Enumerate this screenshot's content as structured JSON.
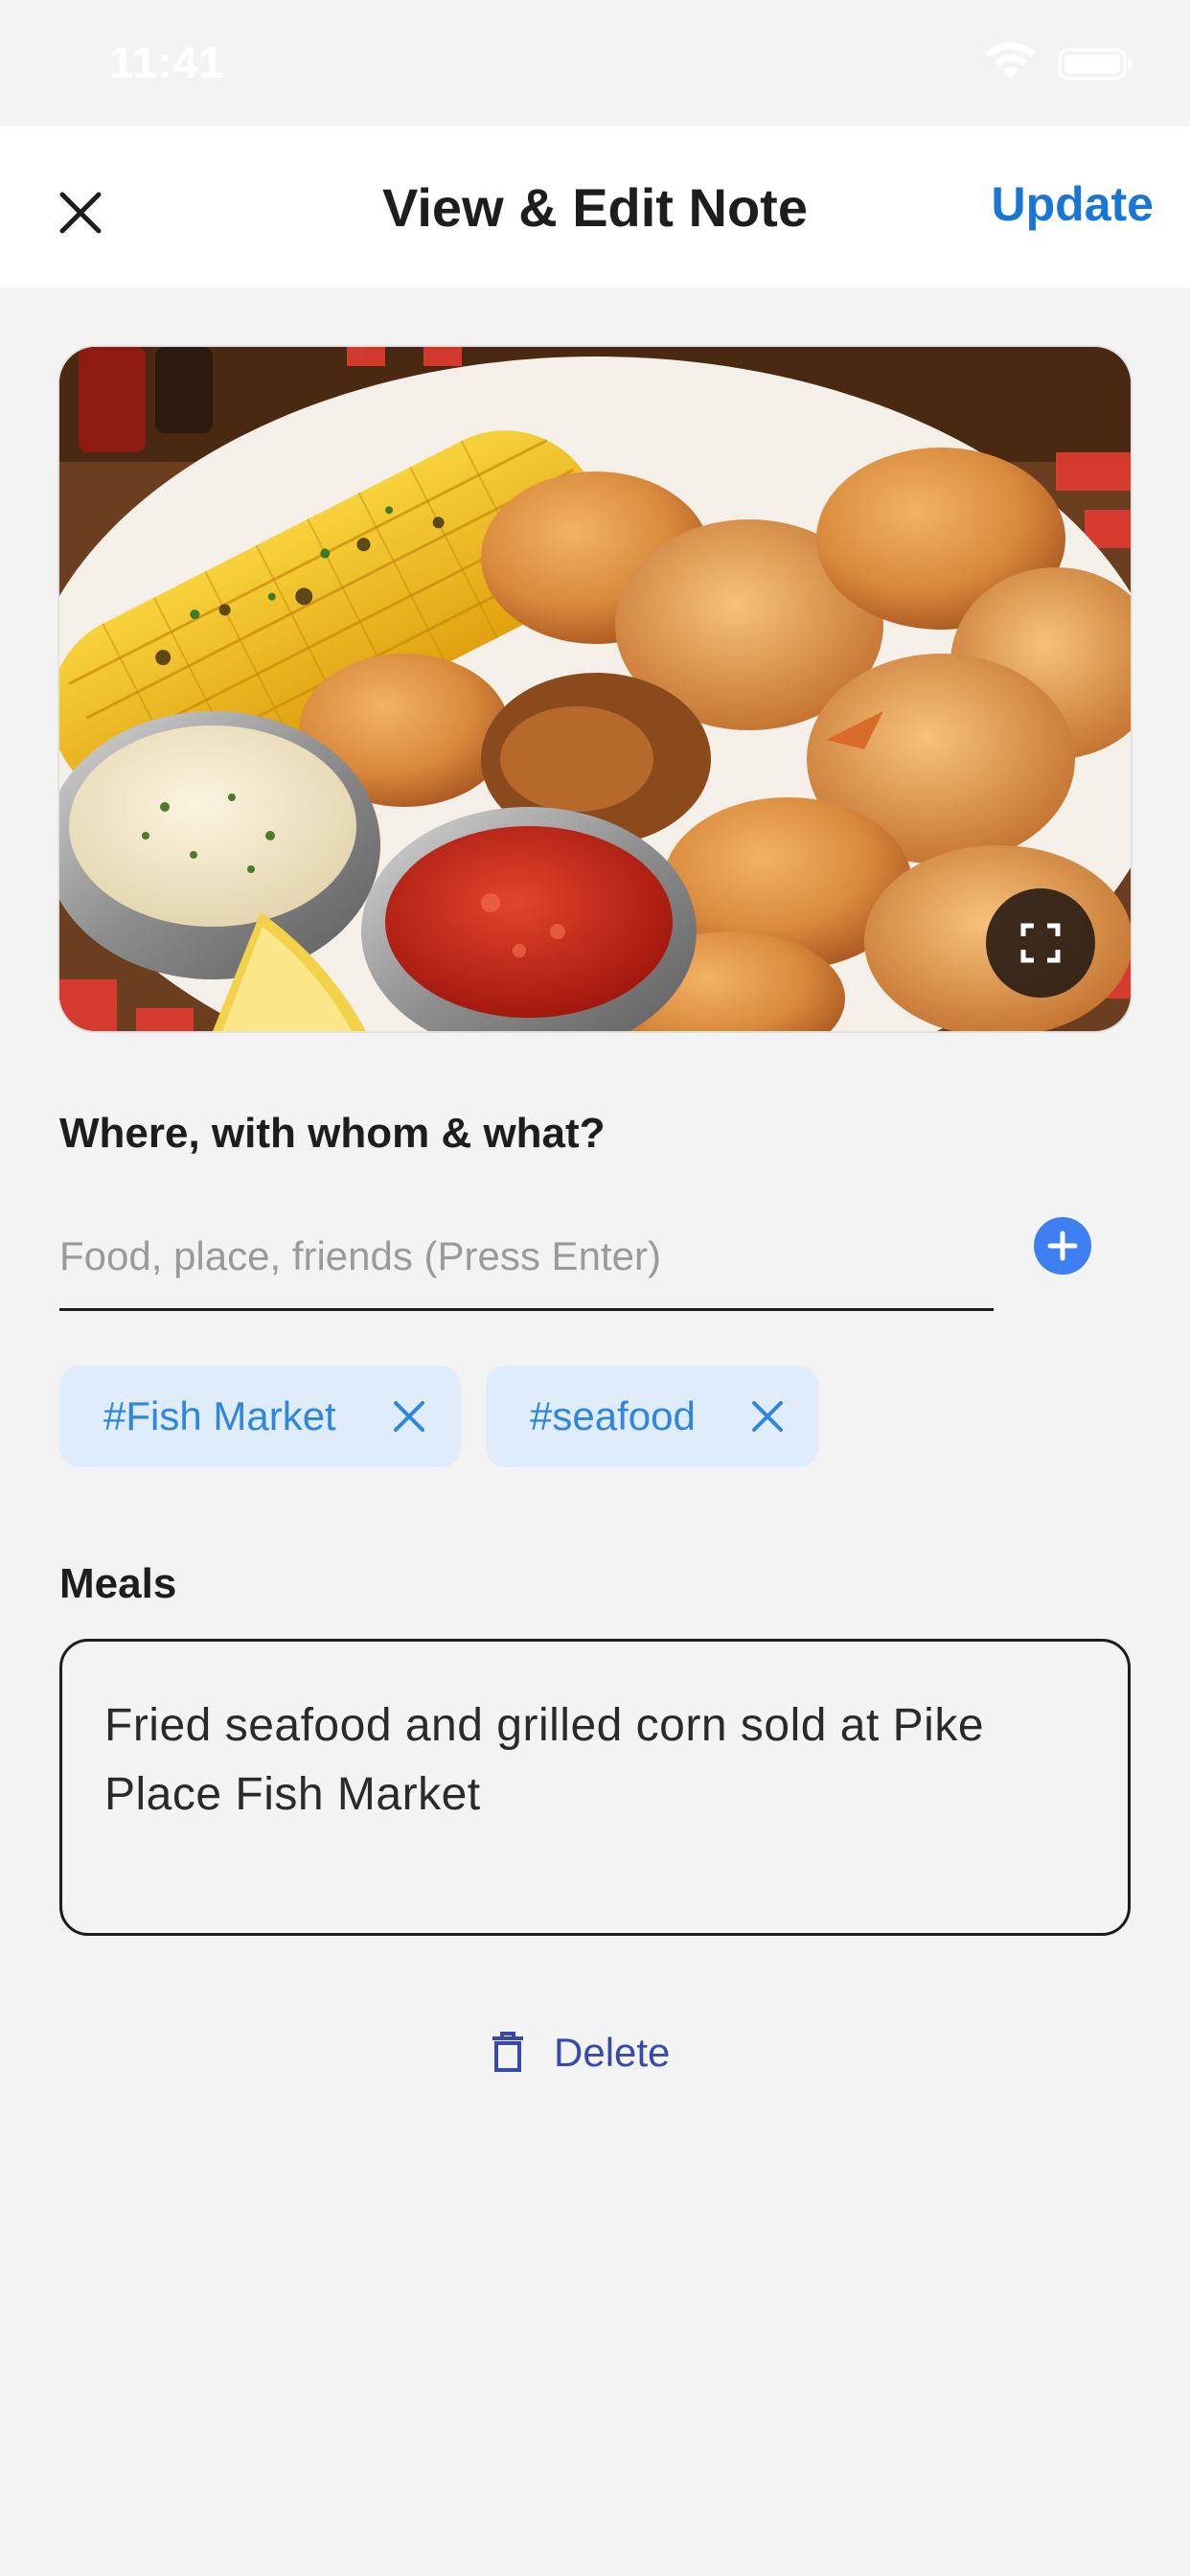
{
  "status_bar": {
    "time": "11:41"
  },
  "nav": {
    "title": "View & Edit Note",
    "update_label": "Update"
  },
  "photo": {
    "subject": "Fried seafood basket with grilled corn, tartar sauce and cocktail sauce"
  },
  "tags_section": {
    "label": "Where, with whom & what?",
    "input_placeholder": "Food, place, friends (Press Enter)",
    "input_value": "",
    "tags": [
      "#Fish Market",
      "#seafood"
    ]
  },
  "meals_section": {
    "label": "Meals",
    "text": "Fried seafood and grilled corn sold at Pike Place Fish Market"
  },
  "delete_label": "Delete",
  "colors": {
    "accent": "#1976d2",
    "add_button": "#3d7ff0",
    "chip_bg": "#dfecfb",
    "chip_text": "#2e86de",
    "delete": "#3949ab",
    "background": "#f3f3f3"
  },
  "icons": {
    "close": "close-icon",
    "expand": "expand-icon",
    "add": "plus-circle-icon",
    "chip_remove": "close-icon",
    "delete": "trash-icon"
  }
}
